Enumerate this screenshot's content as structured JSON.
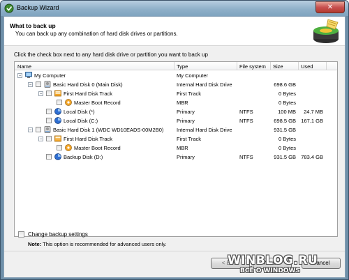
{
  "window": {
    "title": "Backup Wizard",
    "close_glyph": "✕"
  },
  "header": {
    "title": "What to back up",
    "subtitle": "You can back up any combination of hard disk drives or partitions."
  },
  "instruction": "Click the check box next to any hard disk drive or partition you want to back up",
  "columns": {
    "name": "Name",
    "type": "Type",
    "filesystem": "File system",
    "size": "Size",
    "used": "Used"
  },
  "rows": [
    {
      "level": 0,
      "expander": "−",
      "checkbox": false,
      "icon": "computer-icon",
      "name": "My Computer",
      "type": "My Computer",
      "fs": "",
      "size": "",
      "used": ""
    },
    {
      "level": 1,
      "expander": "−",
      "checkbox": true,
      "icon": "hard-disk-icon",
      "name": "Basic Hard Disk 0 (Main Disk)",
      "type": "Internal Hard Disk Drive",
      "fs": "",
      "size": "698.6 GB",
      "used": ""
    },
    {
      "level": 2,
      "expander": "−",
      "checkbox": true,
      "icon": "disk-track-icon",
      "name": "First Hard Disk Track",
      "type": "First Track",
      "fs": "",
      "size": "0 Bytes",
      "used": ""
    },
    {
      "level": 3,
      "expander": "",
      "checkbox": true,
      "icon": "boot-record-icon",
      "name": "Master Boot Record",
      "type": "MBR",
      "fs": "",
      "size": "0 Bytes",
      "used": ""
    },
    {
      "level": 2,
      "expander": "",
      "checkbox": true,
      "icon": "partition-icon",
      "name": "Local Disk (*)",
      "type": "Primary",
      "fs": "NTFS",
      "size": "100 MB",
      "used": "24.7 MB"
    },
    {
      "level": 2,
      "expander": "",
      "checkbox": true,
      "icon": "partition-icon",
      "name": "Local Disk (C:)",
      "type": "Primary",
      "fs": "NTFS",
      "size": "698.5 GB",
      "used": "167.1 GB"
    },
    {
      "level": 1,
      "expander": "−",
      "checkbox": true,
      "icon": "hard-disk-icon",
      "name": "Basic Hard Disk 1 (WDC WD10EADS-00M2B0)",
      "type": "Internal Hard Disk Drive",
      "fs": "",
      "size": "931.5 GB",
      "used": ""
    },
    {
      "level": 2,
      "expander": "−",
      "checkbox": true,
      "icon": "disk-track-icon",
      "name": "First Hard Disk Track",
      "type": "First Track",
      "fs": "",
      "size": "0 Bytes",
      "used": ""
    },
    {
      "level": 3,
      "expander": "",
      "checkbox": true,
      "icon": "boot-record-icon",
      "name": "Master Boot Record",
      "type": "MBR",
      "fs": "",
      "size": "0 Bytes",
      "used": ""
    },
    {
      "level": 2,
      "expander": "",
      "checkbox": true,
      "icon": "partition-icon",
      "name": "Backup Disk (D:)",
      "type": "Primary",
      "fs": "NTFS",
      "size": "931.5 GB",
      "used": "783.4 GB"
    }
  ],
  "options": {
    "change_label": "Change backup settings",
    "note_label": "Note:",
    "note_text": "This option is recommended for advanced users only."
  },
  "buttons": {
    "back": "< Back",
    "next": "Next >",
    "cancel": "Cancel"
  },
  "watermark": {
    "line1": "WINBLOG.RU",
    "line2": "ВСЁ О WINDOWS"
  },
  "colors": {
    "title_bar": "#8fb0c9",
    "partition_blue": "#2f6fd3",
    "track_orange": "#f4a72a"
  }
}
